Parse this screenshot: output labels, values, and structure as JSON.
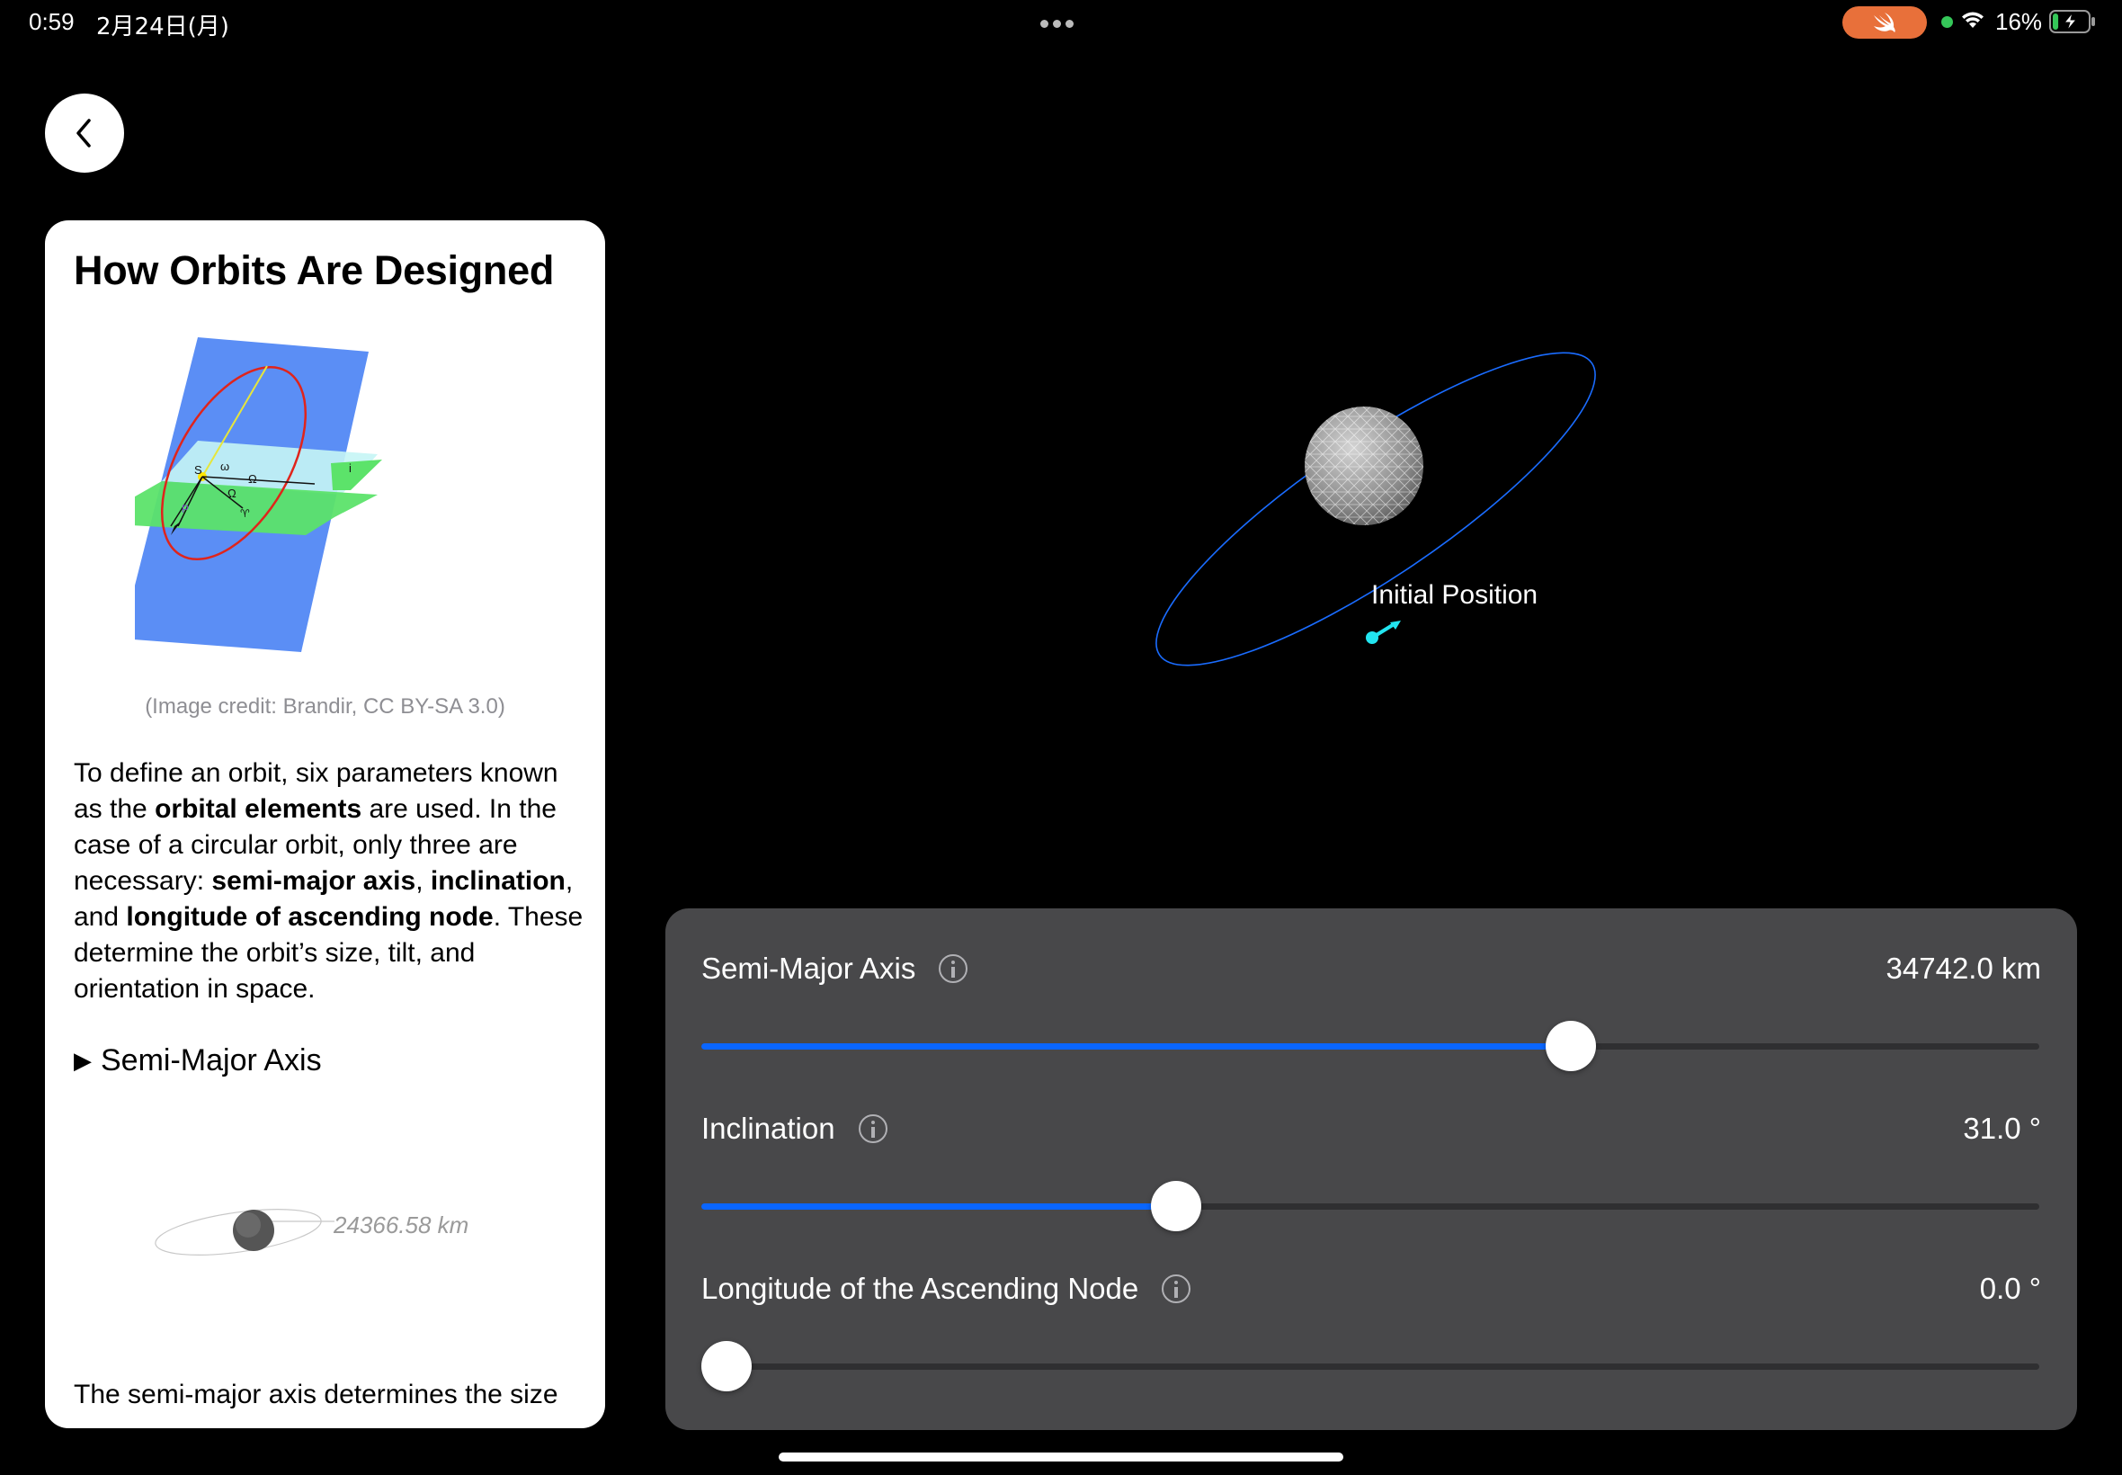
{
  "status_bar": {
    "time": "0:59",
    "date": "2月24日(月)",
    "battery_pct": "16%",
    "battery_level": 0.16,
    "swift_badge_color": "#e8703a",
    "mic_indicator_color": "#35c759"
  },
  "navigation": {
    "back_icon": "chevron-left-icon"
  },
  "article": {
    "title": "How Orbits Are Designed",
    "diagram_labels": {
      "s": "S",
      "omega": "ω",
      "big_omega_1": "Ω",
      "big_omega_2": "Ω",
      "i": "i",
      "p": "P",
      "aries": "♈"
    },
    "image_credit": "(Image credit: Brandir, CC BY-SA 3.0)",
    "paragraph": {
      "p1": "To define an orbit, six parameters known as the ",
      "b1": "orbital elements",
      "p2": " are used. In the case of a circular orbit, only three are necessary: ",
      "b2": "semi-major axis",
      "p3": ", ",
      "b3": "inclination",
      "p4": ", and ",
      "b4": "longitude of ascending node",
      "p5": ". These determine the orbit’s size, tilt, and orientation in space."
    },
    "section_marker": "▶",
    "section_title": "Semi-Major Axis",
    "mini_orbit_label": "24366.58 km",
    "cutoff_text": "The semi-major axis determines the size"
  },
  "scene": {
    "initial_position_label": "Initial Position",
    "orbit_color": "#1a6cff",
    "marker_color": "#22e5f0"
  },
  "controls": {
    "accent": "#0a66ff",
    "sliders": [
      {
        "label": "Semi-Major Axis",
        "value": "34742.0 km",
        "fraction": 0.65
      },
      {
        "label": "Inclination",
        "value": "31.0 °",
        "fraction": 0.355
      },
      {
        "label": "Longitude of the Ascending Node",
        "value": "0.0 °",
        "fraction": 0.0
      }
    ]
  }
}
